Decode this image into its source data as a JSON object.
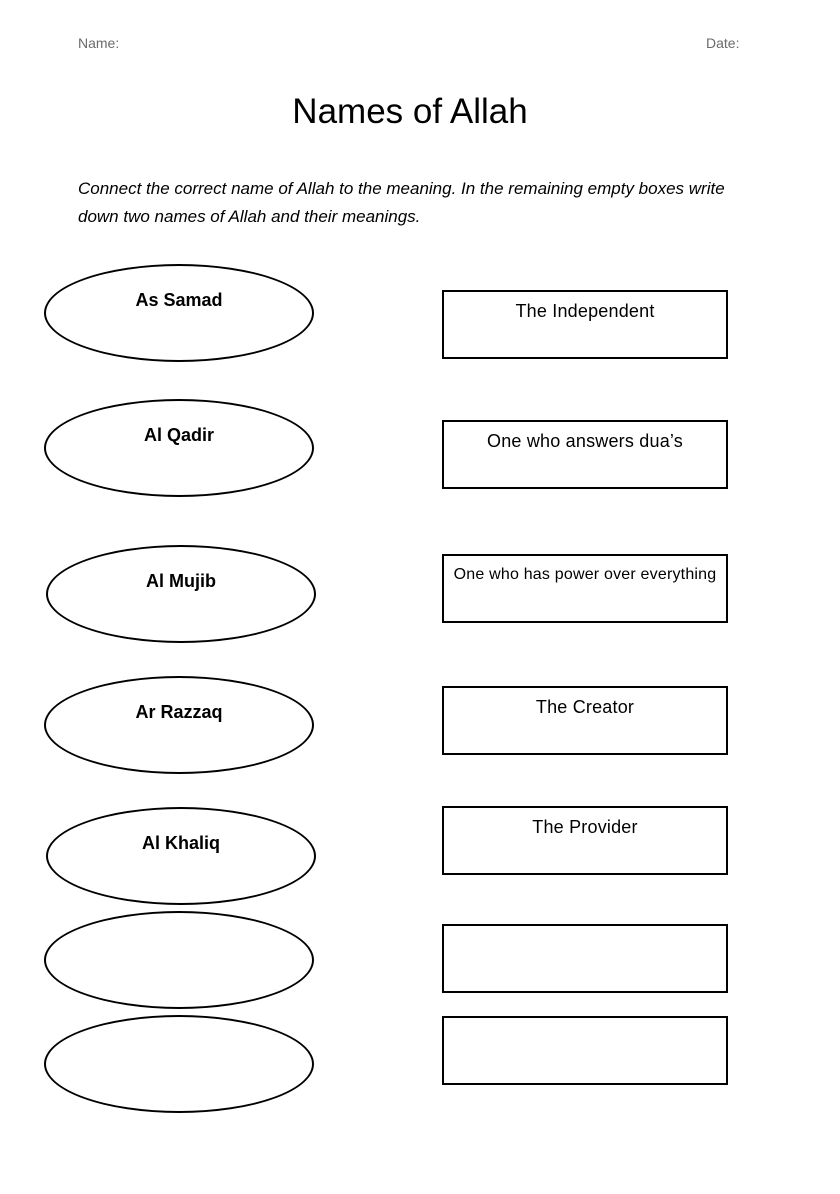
{
  "header": {
    "name_label": "Name:",
    "date_label": "Date:"
  },
  "title": "Names of Allah",
  "instructions": "Connect the correct name of Allah to the meaning. In the remaining empty boxes write down two names of Allah and their meanings.",
  "names": [
    {
      "label": "As Samad"
    },
    {
      "label": "Al Qadir"
    },
    {
      "label": "Al Mujib"
    },
    {
      "label": "Ar Razzaq"
    },
    {
      "label": "Al Khaliq"
    },
    {
      "label": ""
    },
    {
      "label": ""
    }
  ],
  "meanings": [
    {
      "label": "The Independent"
    },
    {
      "label": "One who answers dua’s"
    },
    {
      "label": "One who has power over everything"
    },
    {
      "label": "The Creator"
    },
    {
      "label": "The Provider"
    },
    {
      "label": ""
    },
    {
      "label": ""
    }
  ]
}
